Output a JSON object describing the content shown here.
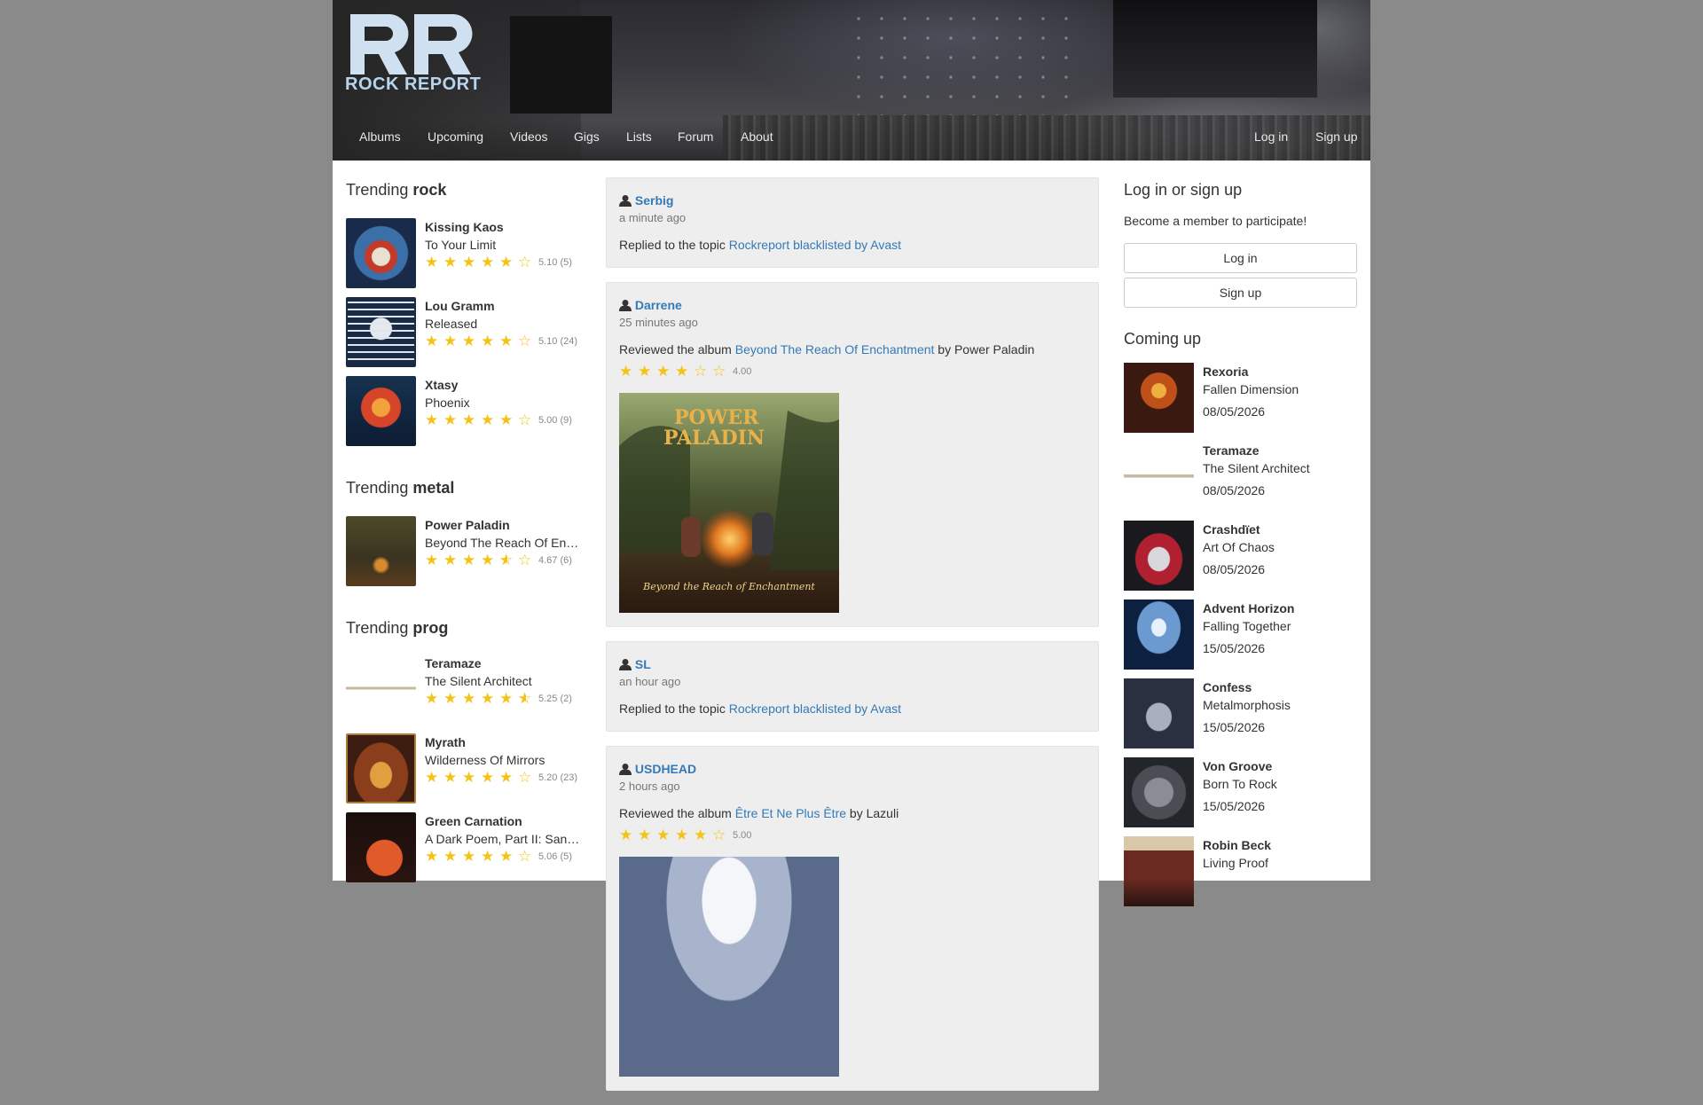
{
  "brand": {
    "name": "ROCK REPORT"
  },
  "nav": {
    "items": [
      "Albums",
      "Upcoming",
      "Videos",
      "Gigs",
      "Lists",
      "Forum",
      "About"
    ],
    "login": "Log in",
    "signup": "Sign up"
  },
  "trending": [
    {
      "prefix": "Trending",
      "genre": "rock",
      "items": [
        {
          "artist": "Kissing Kaos",
          "album": "To Your Limit",
          "rating": 5.1,
          "rating_text": "5.10 (5)",
          "stars": 5
        },
        {
          "artist": "Lou Gramm",
          "album": "Released",
          "rating": 5.1,
          "rating_text": "5.10 (24)",
          "stars": 5
        },
        {
          "artist": "Xtasy",
          "album": "Phoenix",
          "rating": 5.0,
          "rating_text": "5.00 (9)",
          "stars": 5
        }
      ]
    },
    {
      "prefix": "Trending",
      "genre": "metal",
      "items": [
        {
          "artist": "Power Paladin",
          "album": "Beyond The Reach Of Enchantment",
          "rating": 4.67,
          "rating_text": "4.67 (6)",
          "stars": 4.5
        }
      ]
    },
    {
      "prefix": "Trending",
      "genre": "prog",
      "items": [
        {
          "artist": "Teramaze",
          "album": "The Silent Architect",
          "rating": 5.25,
          "rating_text": "5.25 (2)",
          "stars": 5.5
        },
        {
          "artist": "Myrath",
          "album": "Wilderness Of Mirrors",
          "rating": 5.2,
          "rating_text": "5.20 (23)",
          "stars": 5
        },
        {
          "artist": "Green Carnation",
          "album": "A Dark Poem, Part II: Sanguis",
          "rating": 5.06,
          "rating_text": "5.06 (5)",
          "stars": 5
        }
      ]
    }
  ],
  "activity": [
    {
      "user": "Serbig",
      "ago": "a minute ago",
      "action": "Replied to the topic",
      "link": "Rockreport blacklisted by Avast"
    },
    {
      "user": "Darrene",
      "ago": "25 minutes ago",
      "action": "Reviewed the album",
      "link": "Beyond The Reach Of Enchantment",
      "by": "by Power Paladin",
      "stars": 4,
      "rating_text": "4.00",
      "cover_title_1": "POWER",
      "cover_title_2": "PALADIN",
      "cover_caption": "Beyond the Reach of Enchantment"
    },
    {
      "user": "SL",
      "ago": "an hour ago",
      "action": "Replied to the topic",
      "link": "Rockreport blacklisted by Avast"
    },
    {
      "user": "USDHEAD",
      "ago": "2 hours ago",
      "action": "Reviewed the album",
      "link": "Être Et Ne Plus Être",
      "by": "by Lazuli",
      "stars": 5,
      "rating_text": "5.00"
    }
  ],
  "sidebar": {
    "login_title": "Log in or sign up",
    "login_sub": "Become a member to participate!",
    "login_button": "Log in",
    "signup_button": "Sign up",
    "coming_title": "Coming up",
    "coming": [
      {
        "artist": "Rexoria",
        "album": "Fallen Dimension",
        "date": "08/05/2026"
      },
      {
        "artist": "Teramaze",
        "album": "The Silent Architect",
        "date": "08/05/2026"
      },
      {
        "artist": "Crashdïet",
        "album": "Art Of Chaos",
        "date": "08/05/2026"
      },
      {
        "artist": "Advent Horizon",
        "album": "Falling Together",
        "date": "15/05/2026"
      },
      {
        "artist": "Confess",
        "album": "Metalmorphosis",
        "date": "15/05/2026"
      },
      {
        "artist": "Von Groove",
        "album": "Born To Rock",
        "date": "15/05/2026"
      },
      {
        "artist": "Robin Beck",
        "album": "Living Proof",
        "date": ""
      }
    ]
  }
}
